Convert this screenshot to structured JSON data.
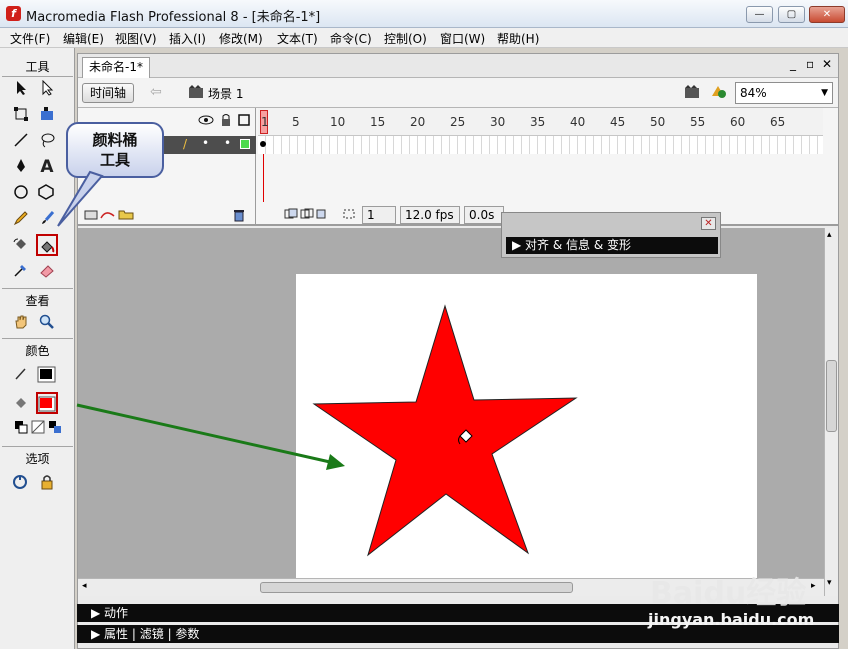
{
  "window": {
    "title": "Macromedia Flash Professional 8 - [未命名-1*]",
    "app_icon": "f"
  },
  "window_buttons": {
    "minimize": "—",
    "maximize": "▢",
    "close": "✕"
  },
  "menu": [
    "文件(F)",
    "编辑(E)",
    "视图(V)",
    "插入(I)",
    "修改(M)",
    "文本(T)",
    "命令(C)",
    "控制(O)",
    "窗口(W)",
    "帮助(H)"
  ],
  "toolbox": {
    "title": "工具",
    "view_label": "查看",
    "color_label": "颜色",
    "options_label": "选项"
  },
  "callout": {
    "line1": "颜料桶",
    "line2": "工具"
  },
  "document": {
    "tab": "未命名-1*",
    "doc_min": "_",
    "doc_restore": "▫",
    "doc_close": "✕"
  },
  "edit_bar": {
    "timeline_button": "时间轴",
    "scene": "场景 1",
    "zoom": "84%"
  },
  "timeline": {
    "frame_numbers": [
      "1",
      "5",
      "10",
      "15",
      "20",
      "25",
      "30",
      "35",
      "40",
      "45",
      "50",
      "55",
      "60",
      "65"
    ],
    "current_frame": "1",
    "fps": "12.0 fps",
    "elapsed": "0.0s"
  },
  "panels": {
    "align": "对齐 & 信息 & 变形",
    "actions": "动作",
    "properties": "属性",
    "filters": "滤镜",
    "params": "参数"
  },
  "colors": {
    "star_fill": "#ff0000",
    "arrow": "#1a7a18",
    "highlight": "#c00000"
  },
  "watermark": {
    "brand": "Baidu经验",
    "url": "jingyan.baidu.com"
  }
}
